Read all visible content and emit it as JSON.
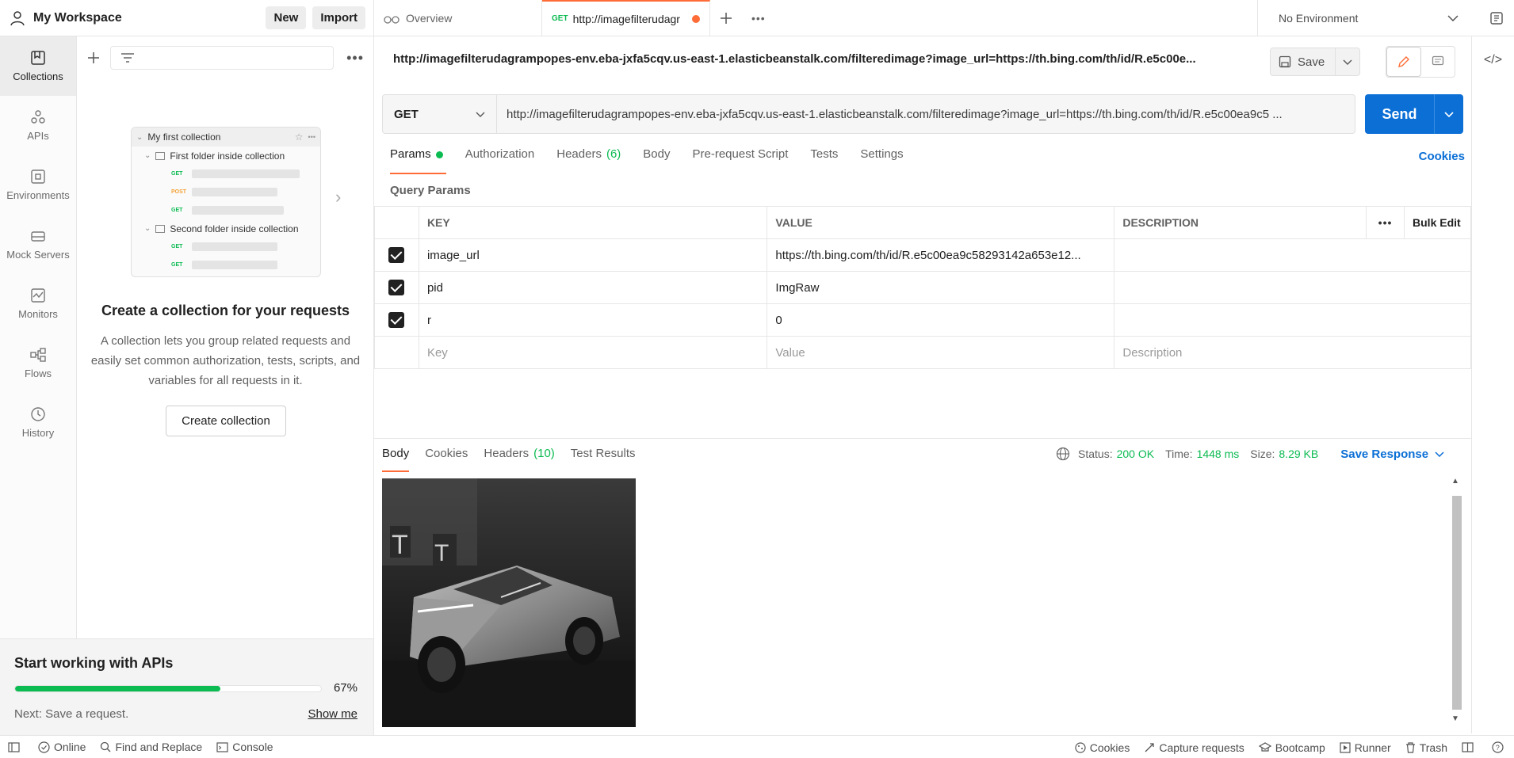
{
  "workspace": {
    "title": "My Workspace",
    "new_label": "New",
    "import_label": "Import"
  },
  "rail": [
    {
      "label": "Collections",
      "icon": "collections-icon"
    },
    {
      "label": "APIs",
      "icon": "apis-icon"
    },
    {
      "label": "Environments",
      "icon": "environments-icon"
    },
    {
      "label": "Mock Servers",
      "icon": "mock-servers-icon"
    },
    {
      "label": "Monitors",
      "icon": "monitors-icon"
    },
    {
      "label": "Flows",
      "icon": "flows-icon"
    },
    {
      "label": "History",
      "icon": "history-icon"
    }
  ],
  "illustration": {
    "collection": "My first collection",
    "folder1": "First folder inside collection",
    "folder2": "Second folder inside collection",
    "get": "GET",
    "post": "POST"
  },
  "empty_state": {
    "title": "Create a collection for your requests",
    "description": "A collection lets you group related requests and easily set common authorization, tests, scripts, and variables for all requests in it.",
    "button": "Create collection"
  },
  "onboarding": {
    "title": "Start working with APIs",
    "progress": 67,
    "progress_label": "67%",
    "next": "Next: Save a request.",
    "show_me": "Show me"
  },
  "tabs": {
    "overview": "Overview",
    "active_method": "GET",
    "active_label": "http://imagefilterudagr",
    "environment": "No Environment"
  },
  "request": {
    "title": "http://imagefilterudagrampopes-env.eba-jxfa5cqv.us-east-1.elasticbeanstalk.com/filteredimage?image_url=https://th.bing.com/th/id/R.e5c00e...",
    "save_label": "Save",
    "method": "GET",
    "url": "http://imagefilterudagrampopes-env.eba-jxfa5cqv.us-east-1.elasticbeanstalk.com/filteredimage?image_url=https://th.bing.com/th/id/R.e5c00ea9c5 ...",
    "send_label": "Send"
  },
  "req_tabs": {
    "params": "Params",
    "authorization": "Authorization",
    "headers": "Headers",
    "headers_count": "(6)",
    "body": "Body",
    "prerequest": "Pre-request Script",
    "tests": "Tests",
    "settings": "Settings",
    "cookies": "Cookies"
  },
  "params": {
    "section_label": "Query Params",
    "col_key": "KEY",
    "col_value": "VALUE",
    "col_desc": "DESCRIPTION",
    "bulk_edit": "Bulk Edit",
    "rows": [
      {
        "key": "image_url",
        "value": "https://th.bing.com/th/id/R.e5c00ea9c58293142a653e12..."
      },
      {
        "key": "pid",
        "value": "ImgRaw"
      },
      {
        "key": "r",
        "value": "0"
      }
    ],
    "placeholder_key": "Key",
    "placeholder_value": "Value",
    "placeholder_desc": "Description"
  },
  "response": {
    "tab_body": "Body",
    "tab_cookies": "Cookies",
    "tab_headers": "Headers",
    "headers_count": "(10)",
    "tab_tests": "Test Results",
    "status_label": "Status:",
    "status_value": "200 OK",
    "time_label": "Time:",
    "time_value": "1448 ms",
    "size_label": "Size:",
    "size_value": "8.29 KB",
    "save_response": "Save Response"
  },
  "footer": {
    "online": "Online",
    "find_replace": "Find and Replace",
    "console": "Console",
    "cookies": "Cookies",
    "capture": "Capture requests",
    "bootcamp": "Bootcamp",
    "runner": "Runner",
    "trash": "Trash"
  },
  "colors": {
    "accent": "#ff6c37",
    "primary": "#0b6fd6",
    "success": "#0cbb52"
  }
}
